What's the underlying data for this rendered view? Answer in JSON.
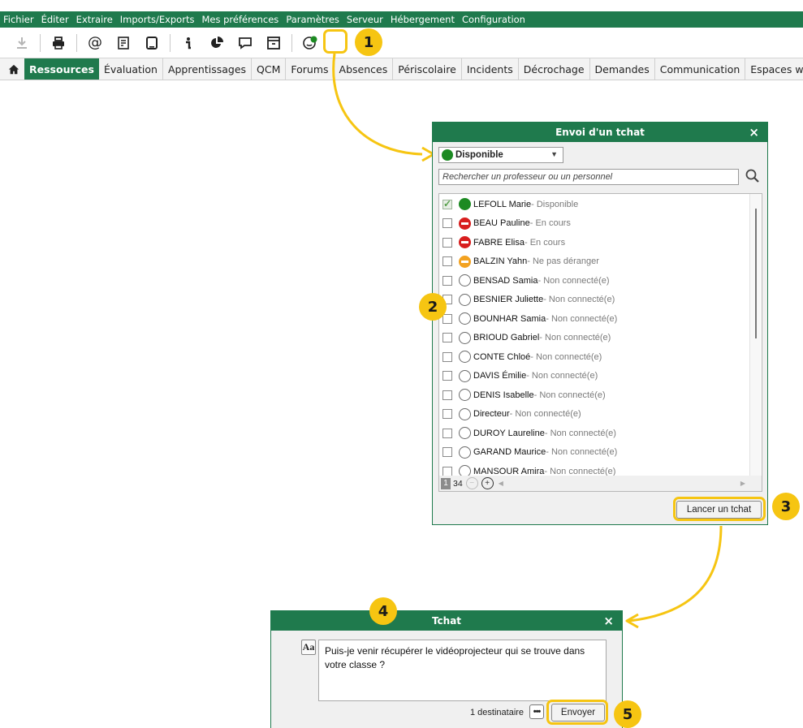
{
  "menu": [
    "Fichier",
    "Éditer",
    "Extraire",
    "Imports/Exports",
    "Mes préférences",
    "Paramètres",
    "Serveur",
    "Hébergement",
    "Configuration"
  ],
  "toolbar": {
    "icons": [
      "download-icon",
      "print-icon",
      "at-icon",
      "document-icon",
      "tablet-icon",
      "info-icon",
      "pie-chart-icon",
      "chat-bubble-icon",
      "window-icon",
      "chat-status-icon"
    ]
  },
  "tabs": {
    "home_icon": "home-icon",
    "items": [
      "Ressources",
      "Évaluation",
      "Apprentissages",
      "QCM",
      "Forums",
      "Absences",
      "Périscolaire",
      "Incidents",
      "Décrochage",
      "Demandes",
      "Communication",
      "Espaces web"
    ],
    "active": "Ressources"
  },
  "colors": {
    "brand_green": "#1f7a4d",
    "callout_yellow": "#f6c512",
    "available": "#1c8a22",
    "busy": "#d81e1e",
    "dnd": "#f3a221"
  },
  "callouts": [
    "1",
    "2",
    "3",
    "4",
    "5"
  ],
  "chat_dialog": {
    "title": "Envoi d'un tchat",
    "close": "×",
    "status_value": "Disponible",
    "search_placeholder": "Rechercher un professeur ou un personnel",
    "people": [
      {
        "name": "LEFOLL Marie",
        "status": "- Disponible",
        "state": "available",
        "checked": true
      },
      {
        "name": "BEAU Pauline",
        "status": "- En cours",
        "state": "busy",
        "checked": false
      },
      {
        "name": "FABRE Elisa",
        "status": "- En cours",
        "state": "busy",
        "checked": false
      },
      {
        "name": "BALZIN Yahn",
        "status": "- Ne pas déranger",
        "state": "dnd",
        "checked": false
      },
      {
        "name": "BENSAD Samia",
        "status": "- Non connecté(e)",
        "state": "offline",
        "checked": false
      },
      {
        "name": "BESNIER Juliette",
        "status": "- Non connecté(e)",
        "state": "offline",
        "checked": false
      },
      {
        "name": "BOUNHAR Samia",
        "status": "- Non connecté(e)",
        "state": "offline",
        "checked": false
      },
      {
        "name": "BRIOUD Gabriel",
        "status": "- Non connecté(e)",
        "state": "offline",
        "checked": false
      },
      {
        "name": "CONTE Chloé",
        "status": "- Non connecté(e)",
        "state": "offline",
        "checked": false
      },
      {
        "name": "DAVIS Émilie",
        "status": "- Non connecté(e)",
        "state": "offline",
        "checked": false
      },
      {
        "name": "DENIS Isabelle",
        "status": "- Non connecté(e)",
        "state": "offline",
        "checked": false
      },
      {
        "name": "Directeur",
        "status": "- Non connecté(e)",
        "state": "offline",
        "checked": false
      },
      {
        "name": "DUROY Laureline",
        "status": "- Non connecté(e)",
        "state": "offline",
        "checked": false
      },
      {
        "name": "GARAND Maurice",
        "status": "- Non connecté(e)",
        "state": "offline",
        "checked": false
      },
      {
        "name": "MANSOUR Amira",
        "status": "- Non connecté(e)",
        "state": "offline",
        "checked": false
      }
    ],
    "pager": {
      "page": "1",
      "total": "34"
    },
    "launch_label": "Lancer un tchat"
  },
  "tchat_dialog": {
    "title": "Tchat",
    "close": "×",
    "format_label": "Aa",
    "message": "Puis-je venir récupérer le vidéoprojecteur qui se trouve dans votre classe ?",
    "recipients": "1 destinataire",
    "more_label": "•••",
    "send_label": "Envoyer"
  }
}
